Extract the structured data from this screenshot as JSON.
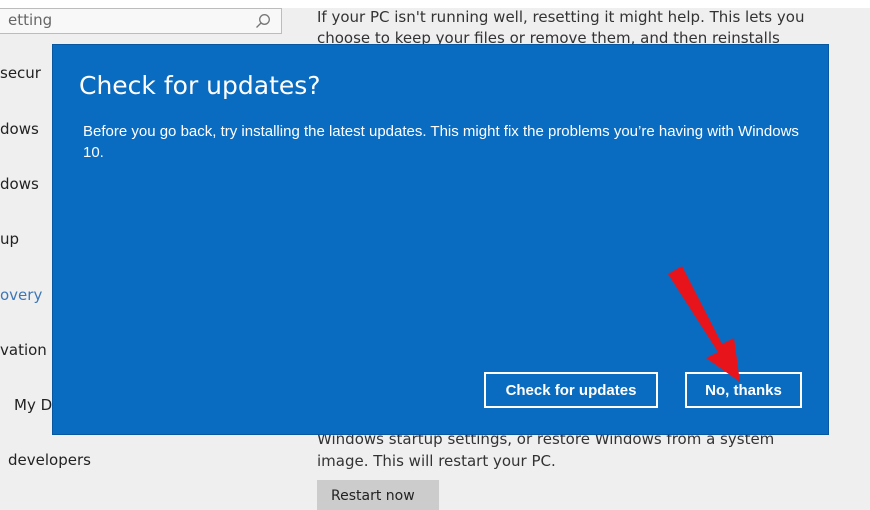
{
  "search": {
    "value": "etting"
  },
  "sidebar": {
    "items": [
      {
        "label": "secur"
      },
      {
        "label": "dows"
      },
      {
        "label": "dows"
      },
      {
        "label": "up"
      },
      {
        "label": "overy"
      },
      {
        "label": "vation"
      },
      {
        "label": "My D"
      },
      {
        "label": "developers"
      }
    ]
  },
  "content": {
    "reset_line1": "If your PC isn't running well, resetting it might help. This lets you",
    "reset_line2": "choose to keep your files or remove them, and then reinstalls",
    "startup_line1": "Windows startup settings, or restore Windows from a system",
    "startup_line2": "image. This will restart your PC.",
    "restart_label": "Restart now"
  },
  "dialog": {
    "title": "Check for updates?",
    "body": "Before you go back, try installing the latest updates. This might fix the problems you’re having with Windows 10.",
    "check_label": "Check for updates",
    "no_label": "No, thanks"
  },
  "colors": {
    "dialog_bg": "#0a6cc0",
    "selected_nav": "#3d77b8",
    "annotation_arrow": "#e8141b"
  }
}
